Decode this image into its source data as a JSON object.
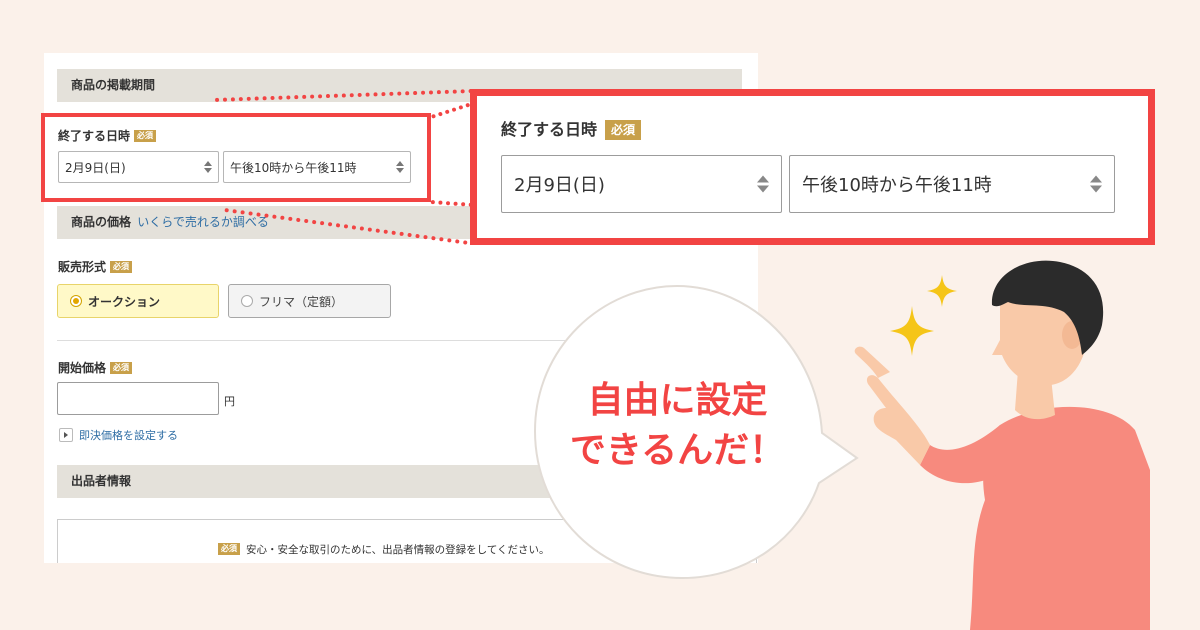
{
  "listing_period": {
    "section_title": "商品の掲載期間",
    "end_datetime_label": "終了する日時",
    "required_badge": "必須",
    "date_value": "2月9日(日)",
    "time_value": "午後10時から午後11時"
  },
  "price": {
    "section_title": "商品の価格",
    "section_link": "いくらで売れるか調べる",
    "sale_format_label": "販売形式",
    "options": [
      "オークション",
      "フリマ（定額）"
    ],
    "selected_option": "オークション",
    "start_price_label": "開始価格",
    "start_price_value": "",
    "currency_unit": "円",
    "buy_now_link": "即決価格を設定する"
  },
  "seller": {
    "section_title": "出品者情報",
    "notice": "安心・安全な取引のために、出品者情報の登録をしてください。"
  },
  "bubble": {
    "line1": "自由に設定",
    "line2": "できるんだ！"
  },
  "colors": {
    "accent_red": "#f24443",
    "badge_gold": "#c8a04a",
    "background": "#fbf1ea",
    "sparkle_yellow": "#f5c518",
    "shirt": "#f78a7e"
  }
}
